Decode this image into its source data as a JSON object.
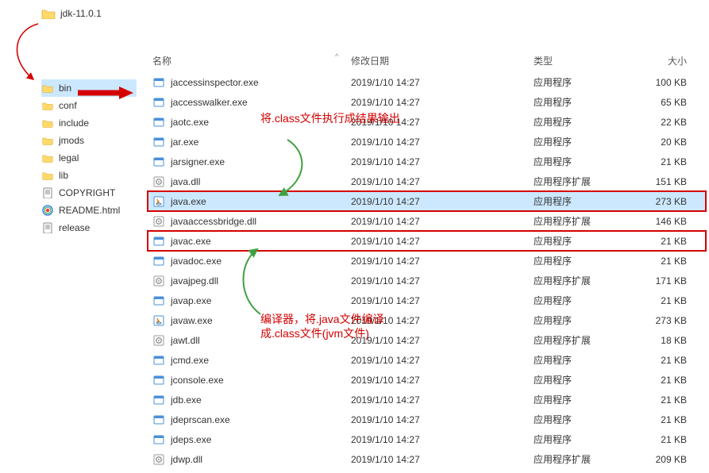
{
  "rootFolder": "jdk-11.0.1",
  "tree": [
    {
      "name": "bin",
      "kind": "folder",
      "selected": true
    },
    {
      "name": "conf",
      "kind": "folder"
    },
    {
      "name": "include",
      "kind": "folder"
    },
    {
      "name": "jmods",
      "kind": "folder"
    },
    {
      "name": "legal",
      "kind": "folder"
    },
    {
      "name": "lib",
      "kind": "folder"
    },
    {
      "name": "COPYRIGHT",
      "kind": "text"
    },
    {
      "name": "README.html",
      "kind": "html"
    },
    {
      "name": "release",
      "kind": "text"
    }
  ],
  "headers": {
    "name": "名称",
    "date": "修改日期",
    "type": "类型",
    "size": "大小"
  },
  "files": [
    {
      "name": "jaccessinspector.exe",
      "date": "2019/1/10 14:27",
      "type": "应用程序",
      "size": "100 KB",
      "icon": "exe"
    },
    {
      "name": "jaccesswalker.exe",
      "date": "2019/1/10 14:27",
      "type": "应用程序",
      "size": "65 KB",
      "icon": "exe"
    },
    {
      "name": "jaotc.exe",
      "date": "2019/1/10 14:27",
      "type": "应用程序",
      "size": "22 KB",
      "icon": "exe"
    },
    {
      "name": "jar.exe",
      "date": "2019/1/10 14:27",
      "type": "应用程序",
      "size": "20 KB",
      "icon": "exe"
    },
    {
      "name": "jarsigner.exe",
      "date": "2019/1/10 14:27",
      "type": "应用程序",
      "size": "21 KB",
      "icon": "exe"
    },
    {
      "name": "java.dll",
      "date": "2019/1/10 14:27",
      "type": "应用程序扩展",
      "size": "151 KB",
      "icon": "dll"
    },
    {
      "name": "java.exe",
      "date": "2019/1/10 14:27",
      "type": "应用程序",
      "size": "273 KB",
      "icon": "java",
      "selected": true,
      "boxed": true
    },
    {
      "name": "javaaccessbridge.dll",
      "date": "2019/1/10 14:27",
      "type": "应用程序扩展",
      "size": "146 KB",
      "icon": "dll"
    },
    {
      "name": "javac.exe",
      "date": "2019/1/10 14:27",
      "type": "应用程序",
      "size": "21 KB",
      "icon": "exe",
      "boxed": true
    },
    {
      "name": "javadoc.exe",
      "date": "2019/1/10 14:27",
      "type": "应用程序",
      "size": "21 KB",
      "icon": "exe"
    },
    {
      "name": "javajpeg.dll",
      "date": "2019/1/10 14:27",
      "type": "应用程序扩展",
      "size": "171 KB",
      "icon": "dll"
    },
    {
      "name": "javap.exe",
      "date": "2019/1/10 14:27",
      "type": "应用程序",
      "size": "21 KB",
      "icon": "exe"
    },
    {
      "name": "javaw.exe",
      "date": "2019/1/10 14:27",
      "type": "应用程序",
      "size": "273 KB",
      "icon": "java"
    },
    {
      "name": "jawt.dll",
      "date": "2019/1/10 14:27",
      "type": "应用程序扩展",
      "size": "18 KB",
      "icon": "dll"
    },
    {
      "name": "jcmd.exe",
      "date": "2019/1/10 14:27",
      "type": "应用程序",
      "size": "21 KB",
      "icon": "exe"
    },
    {
      "name": "jconsole.exe",
      "date": "2019/1/10 14:27",
      "type": "应用程序",
      "size": "21 KB",
      "icon": "exe"
    },
    {
      "name": "jdb.exe",
      "date": "2019/1/10 14:27",
      "type": "应用程序",
      "size": "21 KB",
      "icon": "exe"
    },
    {
      "name": "jdeprscan.exe",
      "date": "2019/1/10 14:27",
      "type": "应用程序",
      "size": "21 KB",
      "icon": "exe"
    },
    {
      "name": "jdeps.exe",
      "date": "2019/1/10 14:27",
      "type": "应用程序",
      "size": "21 KB",
      "icon": "exe"
    },
    {
      "name": "jdwp.dll",
      "date": "2019/1/10 14:27",
      "type": "应用程序扩展",
      "size": "209 KB",
      "icon": "dll"
    }
  ],
  "annotations": {
    "top": "将.class文件执行成结果输出",
    "bottom": "编译器，将.java文件编译成.class文件(jvm文件)"
  }
}
